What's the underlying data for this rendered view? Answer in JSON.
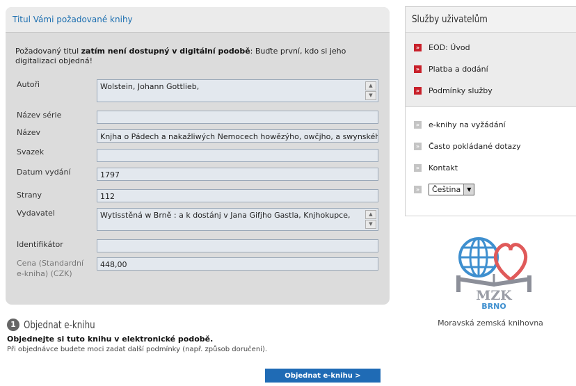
{
  "panel": {
    "title": "Titul Vámi požadované knihy",
    "notice_prefix": "Požadovaný titul ",
    "notice_bold": "zatím není dostupný v digitální podobě",
    "notice_suffix": ": Buďte první, kdo si jeho digitalizaci objedná!"
  },
  "fields": {
    "authors": {
      "label": "Autoři",
      "value": "Wolstein, Johann Gottlieb,"
    },
    "series": {
      "label": "Název série",
      "value": ""
    },
    "title": {
      "label": "Název",
      "value": "Knjha o Pádech a nakažliwých Nemocech howězýho, owčjho, a swynského dobytka"
    },
    "volume": {
      "label": "Svazek",
      "value": ""
    },
    "date": {
      "label": "Datum vydání",
      "value": "1797"
    },
    "pages": {
      "label": "Strany",
      "value": "112"
    },
    "publisher": {
      "label": "Vydavatel",
      "value": "Wytisstěná w Brně : a k dostánj v Jana Gifjho Gastla, Knjhokupce,"
    },
    "identifier": {
      "label": "Identifikátor",
      "value": ""
    },
    "price": {
      "label": "Cena (Standardní e-kniha) (CZK)",
      "value": "448,00"
    }
  },
  "order": {
    "step": "1",
    "title": "Objednat e-knihu",
    "bold": "Objednejte si tuto knihu v elektronické podobě.",
    "note": "Při objednávce budete moci zadat další podmínky (např. způsob doručení).",
    "button": "Objednat e-knihu >"
  },
  "sidebar": {
    "title": "Služby uživatelům",
    "primary_items": [
      {
        "label": "EOD: Úvod",
        "icon": "red-arrow-icon"
      },
      {
        "label": "Platba a dodání",
        "icon": "red-arrow-icon"
      },
      {
        "label": "Podmínky služby",
        "icon": "red-arrow-icon"
      }
    ],
    "secondary_items": [
      {
        "label": "e-knihy na vyžádání",
        "icon": "grey-arrow-icon"
      },
      {
        "label": "Často pokládané dotazy",
        "icon": "grey-arrow-icon"
      },
      {
        "label": "Kontakt",
        "icon": "grey-arrow-icon"
      }
    ],
    "language": {
      "selected": "Čeština"
    }
  },
  "logo": {
    "text": "MZK",
    "subtext": "BRNO"
  },
  "library_name": "Moravská zemská knihovna",
  "colors": {
    "accent": "#1f6bb5",
    "brand_red": "#c8202a",
    "panel_bg": "#dcdcdc"
  }
}
